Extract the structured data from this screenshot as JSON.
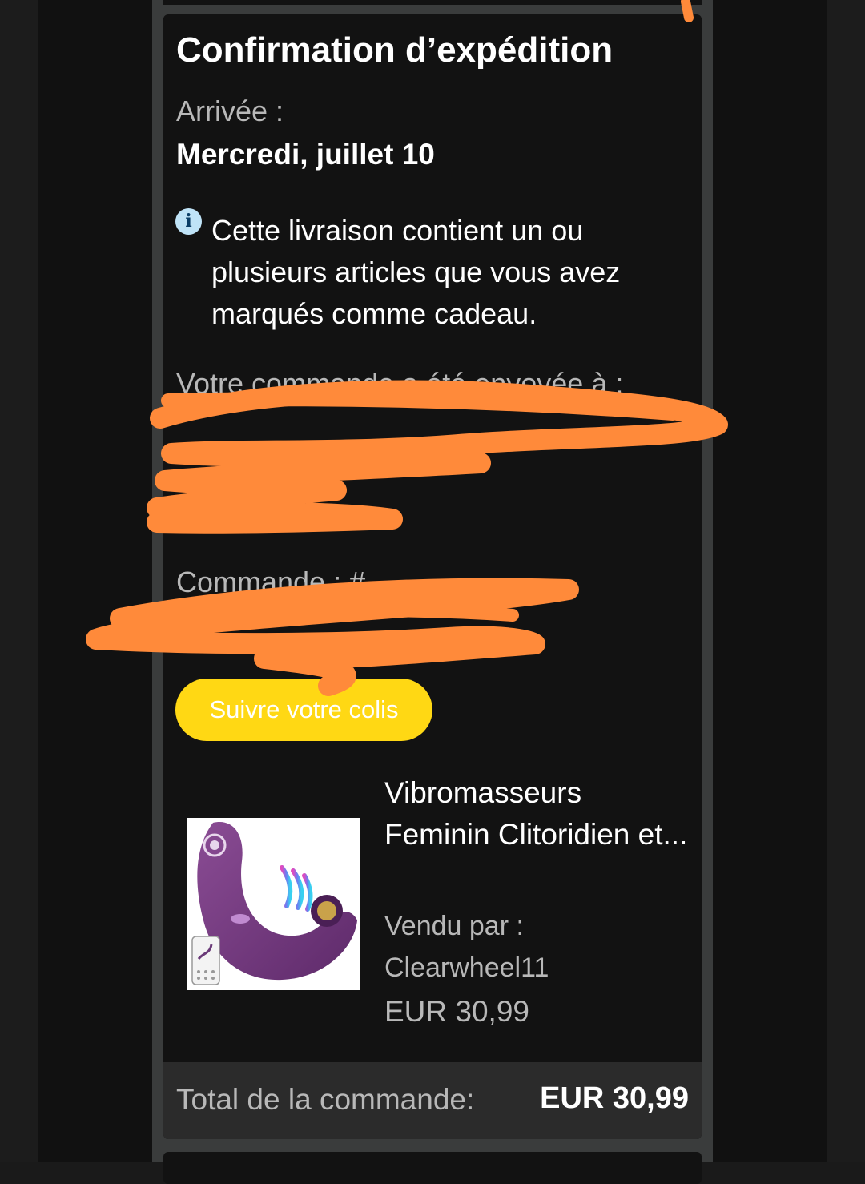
{
  "shipment": {
    "title": "Confirmation d’expédition",
    "arrival_label": "Arrivée :",
    "arrival_date": "Mercredi, juillet 10",
    "info_icon": "info-icon",
    "info_icon_glyph": "i",
    "gift_note": "Cette livraison contient un ou plusieurs articles que vous avez marqués comme cadeau.",
    "sent_to_label": "Votre commande a été envoyée à :",
    "order_label": "Commande : #",
    "track_button_label": "Suivre votre colis"
  },
  "product": {
    "name": "Vibromasseurs Feminin Clitoridien et...",
    "sold_by_label": "Vendu par :",
    "seller": "Clearwheel11",
    "price": "EUR 30,99"
  },
  "total": {
    "label": "Total de la commande:",
    "value": "EUR 30,99"
  },
  "colors": {
    "button": "#ffd814",
    "link": "#5fb3d9",
    "redaction": "#ff8a3a",
    "card": "#121212"
  }
}
